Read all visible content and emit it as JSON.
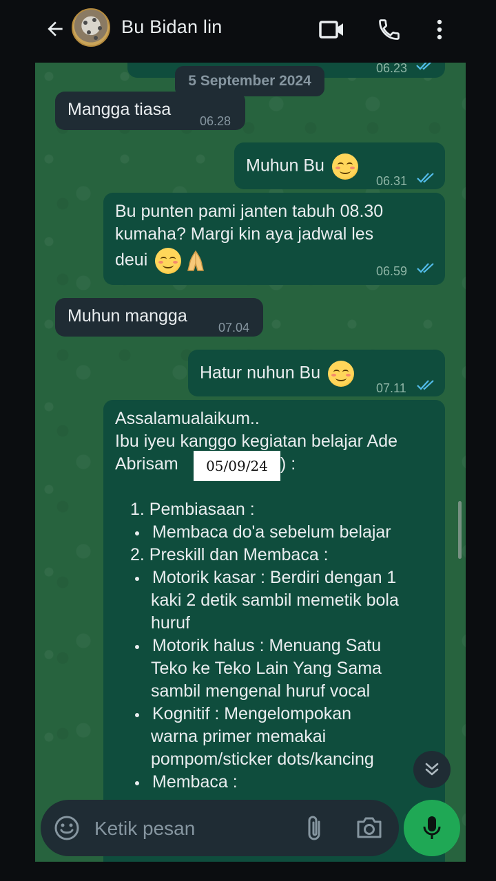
{
  "header": {
    "title": "Bu Bidan lin"
  },
  "chat": {
    "date_pill": "5 September 2024",
    "prev_time": "06.23",
    "messages": [
      {
        "text": "Mangga tiasa",
        "time": "06.28"
      },
      {
        "text": "Muhun Bu",
        "time": "06.31"
      },
      {
        "line1": "Bu punten pami janten tabuh 08.30",
        "line2": "kumaha? Margi kin aya jadwal les",
        "line3": "deui",
        "time": "06.59"
      },
      {
        "text": "Muhun mangga",
        "time": "07.04"
      },
      {
        "text": "Hatur nuhun Bu",
        "time": "07.11"
      }
    ],
    "long_message": {
      "greeting": "Assalamualaikum..",
      "line2": "Ibu iyeu kanggo kegiatan belajar Ade",
      "line3_prefix": "Abrisam",
      "redacted_date": "05/09/24",
      "line3_suffix": ") :",
      "items": [
        "1. Pembiasaan :",
        "Membaca do'a sebelum belajar",
        "2. Preskill dan Membaca :",
        "Motorik kasar : Berdiri  dengan 1",
        "kaki 2 detik sambil memetik bola",
        "huruf",
        "Motorik halus : Menuang Satu",
        "Teko ke Teko Lain Yang Sama",
        "sambil mengenal huruf vocal",
        "Kognitif : Mengelompokan",
        "warna primer memakai",
        "pompom/sticker dots/kancing",
        "Membaca :"
      ]
    }
  },
  "composer": {
    "placeholder": "Ketik pesan"
  },
  "colors": {
    "chat_bg": "#27633e",
    "incoming_bubble": "#1f2c34",
    "outgoing_bubble": "#0f4d3d",
    "read_ticks": "#53bdeb",
    "mic_button": "#1fa855"
  },
  "icons": [
    "back-arrow-icon",
    "video-call-icon",
    "phone-call-icon",
    "more-options-icon",
    "double-tick-icon",
    "scroll-down-icon",
    "emoji-icon",
    "attach-icon",
    "camera-icon",
    "mic-icon"
  ]
}
